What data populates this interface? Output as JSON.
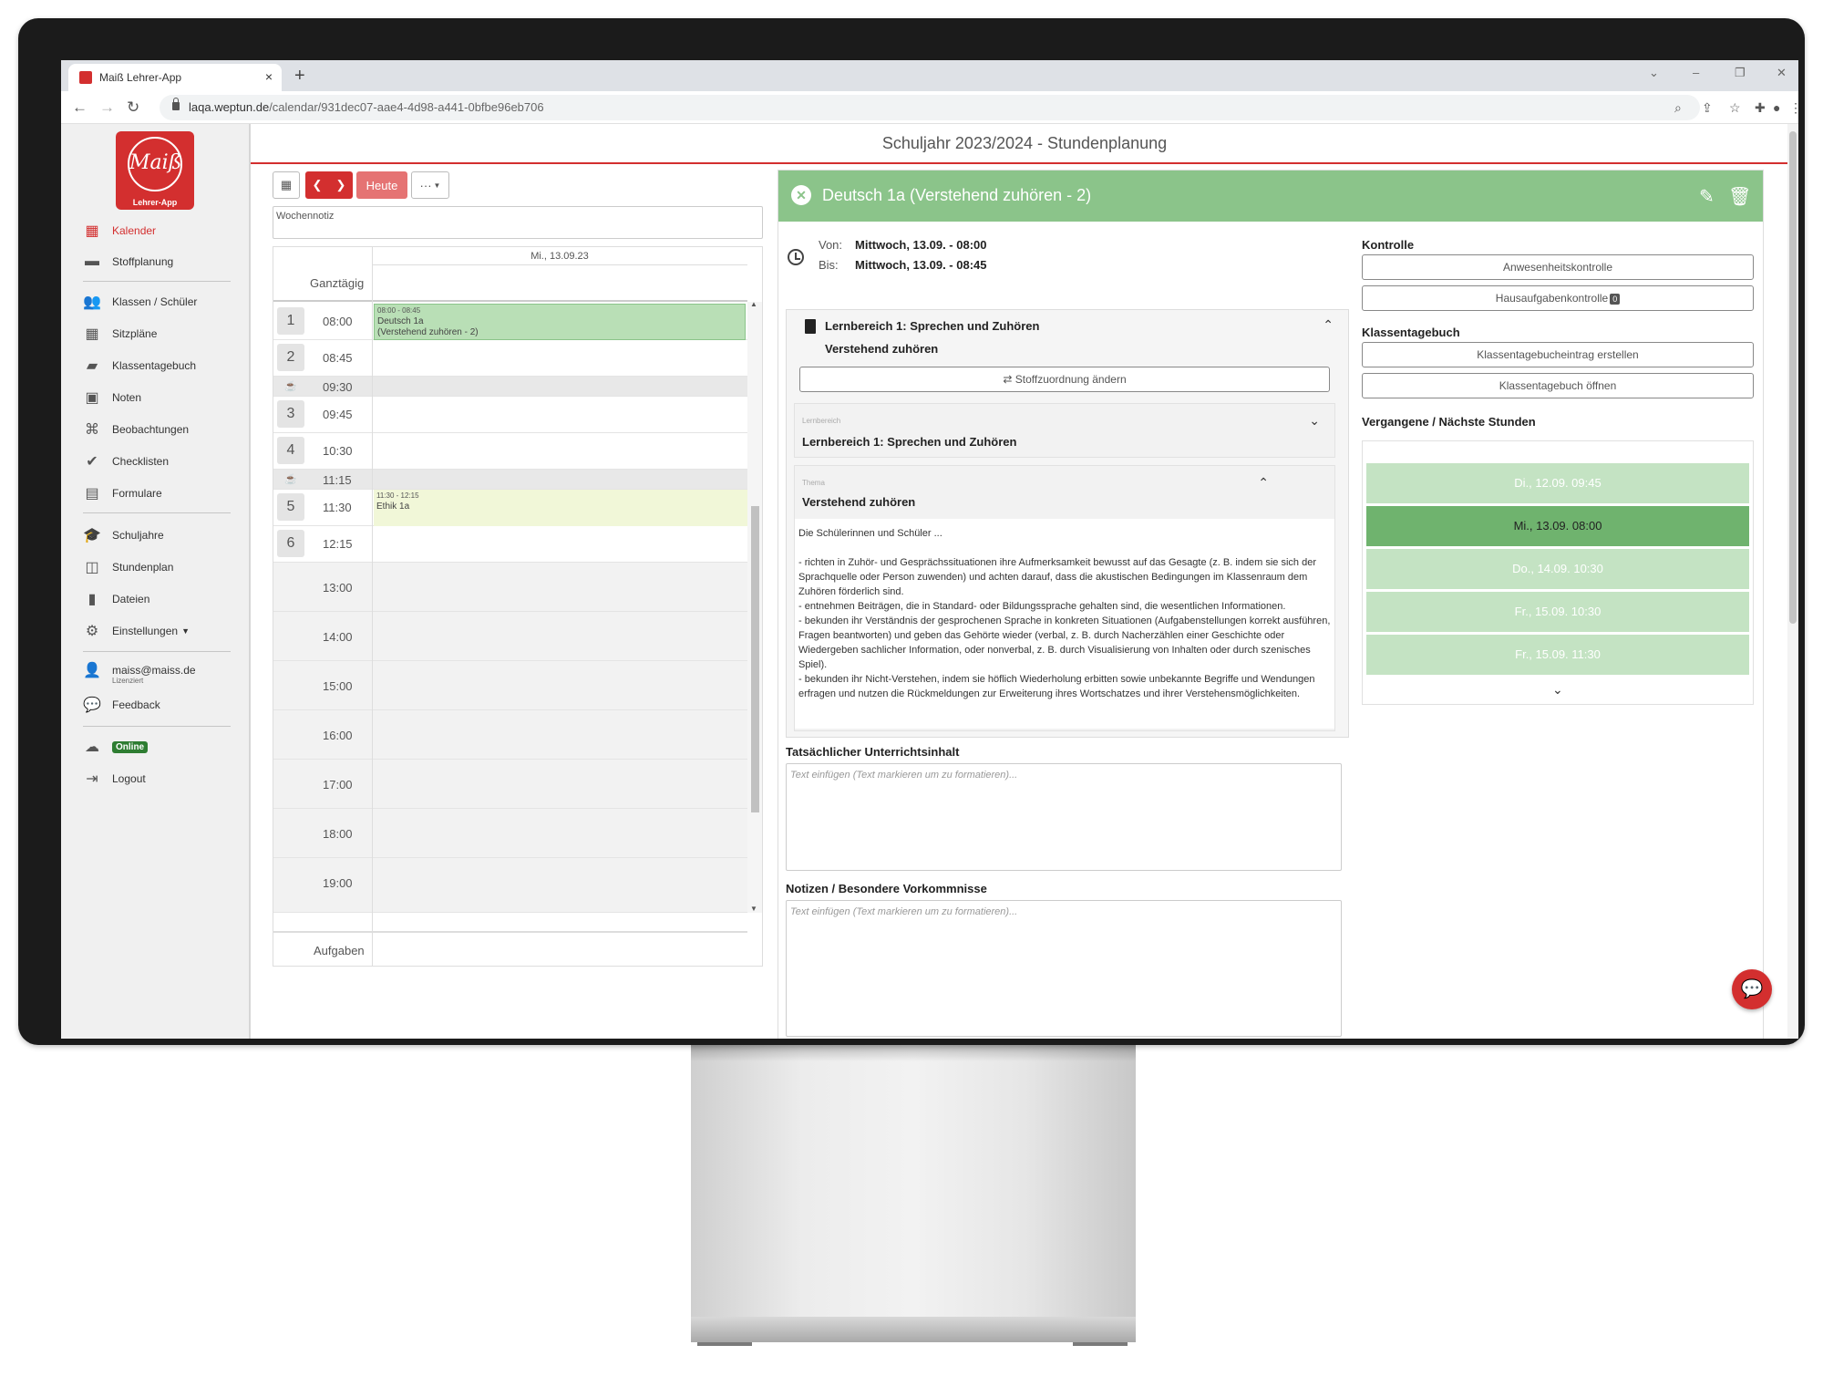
{
  "browser": {
    "tab_title": "Maiß Lehrer-App",
    "tab_close": "×",
    "new_tab": "+",
    "url_host": "laqa.weptun.de",
    "url_path": "/calendar/931dec07-aae4-4d98-a441-0bfbe96eb706"
  },
  "header": {
    "title": "Schuljahr 2023/2024 - Stundenplanung"
  },
  "logo": {
    "text": "Maiß",
    "sub": "Lehrer-App"
  },
  "sidebar": {
    "items": [
      {
        "label": "Kalender",
        "icon": "calendar-icon"
      },
      {
        "label": "Stoffplanung",
        "icon": "inbox-icon"
      },
      {
        "label": "Klassen / Schüler",
        "icon": "users-icon"
      },
      {
        "label": "Sitzpläne",
        "icon": "grid-icon"
      },
      {
        "label": "Klassentagebuch",
        "icon": "book-icon"
      },
      {
        "label": "Noten",
        "icon": "grade-icon"
      },
      {
        "label": "Beobachtungen",
        "icon": "binoculars-icon"
      },
      {
        "label": "Checklisten",
        "icon": "check-circle-icon"
      },
      {
        "label": "Formulare",
        "icon": "file-icon"
      },
      {
        "label": "Schuljahre",
        "icon": "graduation-cap-icon"
      },
      {
        "label": "Stundenplan",
        "icon": "columns-icon"
      },
      {
        "label": "Dateien",
        "icon": "document-icon"
      },
      {
        "label": "Einstellungen",
        "icon": "gear-icon"
      }
    ],
    "user_email": "maiss@maiss.de",
    "licensed": "Lizenziert",
    "feedback": "Feedback",
    "online": "Online",
    "logout": "Logout"
  },
  "calendar": {
    "today_label": "Heute",
    "more_label": "···",
    "wochennotiz": "Wochennotiz",
    "date": "Mi., 13.09.23",
    "ganztaegig": "Ganztägig",
    "periods": [
      {
        "num": "1",
        "time": "08:00"
      },
      {
        "num": "2",
        "time": "08:45"
      },
      {
        "num": "",
        "time": "09:30",
        "break": true
      },
      {
        "num": "3",
        "time": "09:45"
      },
      {
        "num": "4",
        "time": "10:30"
      },
      {
        "num": "",
        "time": "11:15",
        "break": true
      },
      {
        "num": "5",
        "time": "11:30"
      },
      {
        "num": "6",
        "time": "12:15"
      }
    ],
    "hours": [
      "13:00",
      "14:00",
      "15:00",
      "16:00",
      "17:00",
      "18:00",
      "19:00"
    ],
    "events": [
      {
        "time": "08:00 - 08:45",
        "title": "Deutsch 1a",
        "subtitle": "(Verstehend zuhören - 2)",
        "color": "#b9dfb6"
      },
      {
        "time": "11:30 - 12:15",
        "title": "Ethik 1a",
        "color": "#f1f7d8"
      }
    ],
    "aufgaben": "Aufgaben"
  },
  "detail": {
    "title": "Deutsch 1a (Verstehend zuhören - 2)",
    "von_label": "Von:",
    "bis_label": "Bis:",
    "von": "Mittwoch, 13.09. - 08:00",
    "bis": "Mittwoch, 13.09. - 08:45",
    "lernbereich_title": "Lernbereich 1: Sprechen und Zuhören",
    "lernbereich_sub": "Verstehend zuhören",
    "stoff_btn": "⇄  Stoffzuordnung ändern",
    "card1_tiny": "Lernbereich",
    "card1_title": "Lernbereich 1: Sprechen und Zuhören",
    "card2_tiny": "Thema",
    "card2_title": "Verstehend zuhören",
    "desc_intro": "Die Schülerinnen und Schüler ...",
    "desc_lines": [
      "- richten in Zuhör- und Gesprächssituationen ihre Aufmerksamkeit bewusst auf das Gesagte (z. B. indem sie sich der Sprachquelle oder Person zuwenden) und achten darauf, dass die akustischen Bedingungen im Klassenraum dem Zuhören förderlich sind.",
      "- entnehmen Beiträgen, die in Standard- oder Bildungssprache gehalten sind, die wesentlichen Informationen.",
      "- bekunden ihr Verständnis der gesprochenen Sprache in konkreten Situationen (Aufgabenstellungen korrekt ausführen, Fragen beantworten) und geben das Gehörte wieder (verbal, z. B. durch Nacherzählen einer Geschichte oder Wiedergeben sachlicher Information, oder nonverbal, z. B. durch Visualisierung von Inhalten oder durch szenisches Spiel).",
      "- bekunden ihr Nicht-Verstehen, indem sie höflich Wiederholung erbitten sowie unbekannte Begriffe und Wendungen erfragen und nutzen die Rückmeldungen zur Erweiterung ihres Wortschatzes und ihrer Verstehensmöglichkeiten."
    ],
    "inhalt_label": "Tatsächlicher Unterrichtsinhalt",
    "notizen_label": "Notizen / Besondere Vorkommnisse",
    "placeholder": "Text einfügen (Text markieren um zu formatieren)...",
    "kontrolle_label": "Kontrolle",
    "anwesenheit_btn": "Anwesenheitskontrolle",
    "hausaufgaben_btn": "Hausaufgabenkontrolle",
    "hausaufgaben_count": "0",
    "klassentagebuch_label": "Klassentagebuch",
    "kt_create_btn": "Klassentagebucheintrag erstellen",
    "kt_open_btn": "Klassentagebuch öffnen",
    "lessons_label": "Vergangene / Nächste Stunden",
    "lessons": [
      "Di., 12.09. 09:45",
      "Mi., 13.09. 08:00",
      "Do., 14.09. 10:30",
      "Fr., 15.09. 10:30",
      "Fr., 15.09. 11:30"
    ],
    "active_lesson": "Mi., 13.09. 08:00"
  },
  "colors": {
    "brand": "#d32f2f",
    "event_green": "#8bc48a",
    "active_lesson": "#6fb36e"
  }
}
